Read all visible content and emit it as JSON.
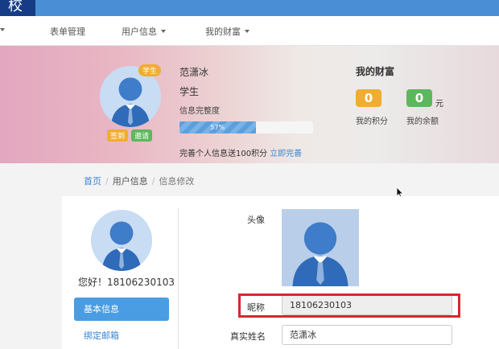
{
  "header": {
    "logo_text": "校"
  },
  "nav": {
    "items": [
      {
        "label": "表单管理",
        "has_dropdown": false
      },
      {
        "label": "用户信息",
        "has_dropdown": true
      },
      {
        "label": "我的财富",
        "has_dropdown": true
      }
    ]
  },
  "banner": {
    "badge": "学生",
    "checkin_label": "签到",
    "invite_label": "邀请",
    "name": "范潇冰",
    "role": "学生",
    "completeness_label": "信息完整度",
    "progress_text": "57%",
    "progress_value": 57,
    "hint": "完善个人信息送100积分",
    "hint_link": "立即完善"
  },
  "wealth": {
    "title": "我的财富",
    "points_value": "0",
    "points_label": "我的积分",
    "balance_value": "0",
    "balance_unit": "元",
    "balance_label": "我的余额"
  },
  "breadcrumb": {
    "home": "首页",
    "section": "用户信息",
    "current": "信息修改"
  },
  "sidebar": {
    "greeting": "您好！18106230103",
    "items": [
      {
        "label": "基本信息",
        "active": true
      },
      {
        "label": "绑定邮箱",
        "active": false
      }
    ]
  },
  "form": {
    "avatar_label": "头像",
    "nickname_label": "昵称",
    "nickname_value": "18106230103",
    "realname_label": "真实姓名",
    "realname_value": "范潇冰"
  },
  "colors": {
    "topbar": "#4a8fd6",
    "logo_bg": "#163c86",
    "accent": "#4a9de2",
    "link": "#3a86d0",
    "badge_orange": "#f0ad2f",
    "points_green": "#5cb85c",
    "highlight_red": "#d9262e"
  },
  "icons": [
    "user-avatar-icon",
    "caret-down-icon",
    "mouse-cursor-icon"
  ]
}
